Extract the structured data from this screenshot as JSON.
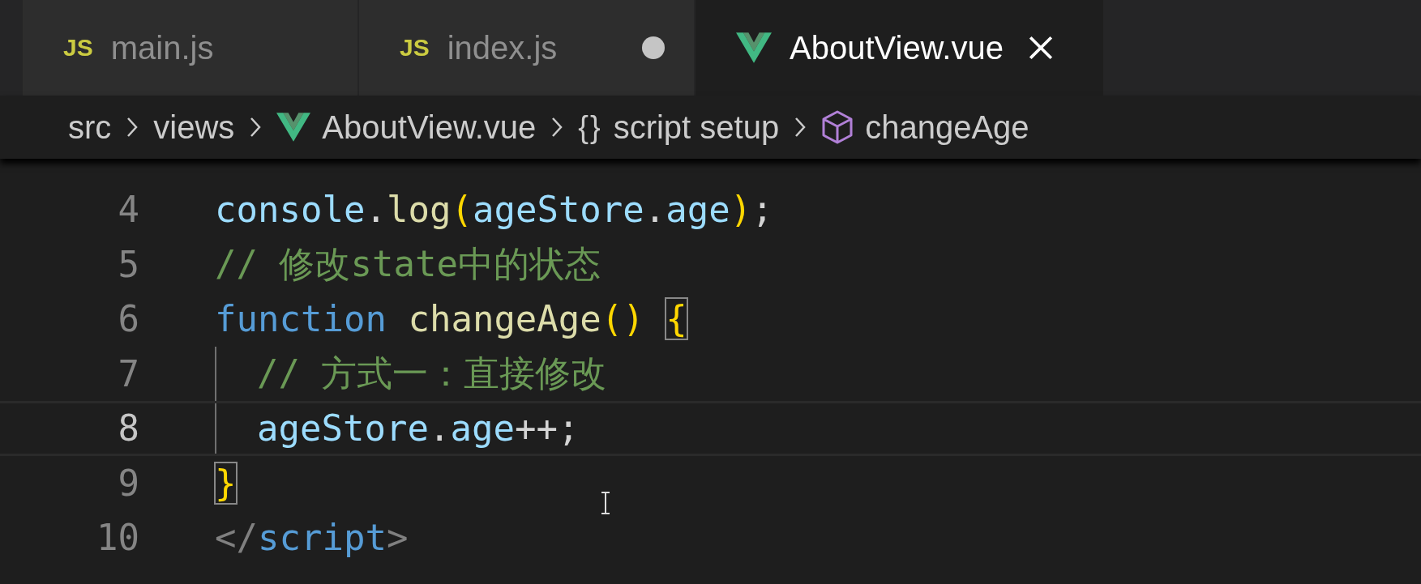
{
  "tabs": [
    {
      "kind": "js",
      "icon_label": "JS",
      "label": "main.js",
      "selected": false,
      "modified": false
    },
    {
      "kind": "js",
      "icon_label": "JS",
      "label": "index.js",
      "selected": false,
      "modified": true
    },
    {
      "kind": "vue",
      "label": "AboutView.vue",
      "selected": true,
      "modified": false
    }
  ],
  "breadcrumb": [
    {
      "kind": "folder",
      "label": "src"
    },
    {
      "kind": "folder",
      "label": "views"
    },
    {
      "kind": "vue",
      "label": "AboutView.vue"
    },
    {
      "kind": "braces",
      "icon_label": "{}",
      "label": "script setup"
    },
    {
      "kind": "symbol",
      "label": "changeAge"
    }
  ],
  "code_lines": [
    {
      "number": "4",
      "current": false,
      "indent_guide": false,
      "tokens": [
        {
          "kind": "var",
          "text": "console"
        },
        {
          "kind": "punct",
          "text": "."
        },
        {
          "kind": "fn",
          "text": "log"
        },
        {
          "kind": "bracket",
          "text": "("
        },
        {
          "kind": "var",
          "text": "ageStore"
        },
        {
          "kind": "punct",
          "text": "."
        },
        {
          "kind": "var",
          "text": "age"
        },
        {
          "kind": "bracket",
          "text": ")"
        },
        {
          "kind": "punct",
          "text": ";"
        }
      ]
    },
    {
      "number": "5",
      "current": false,
      "indent_guide": false,
      "tokens": [
        {
          "kind": "comment",
          "text": "// 修改state中的状态"
        }
      ]
    },
    {
      "number": "6",
      "current": false,
      "indent_guide": false,
      "tokens": [
        {
          "kind": "keyword",
          "text": "function "
        },
        {
          "kind": "fn",
          "text": "changeAge"
        },
        {
          "kind": "bracket",
          "text": "() "
        },
        {
          "kind": "matched",
          "text": "{"
        }
      ]
    },
    {
      "number": "7",
      "current": false,
      "indent_guide": true,
      "tokens": [
        {
          "kind": "comment",
          "text": "// 方式一：直接修改"
        }
      ]
    },
    {
      "number": "8",
      "current": true,
      "indent_guide": true,
      "tokens": [
        {
          "kind": "var",
          "text": "ageStore"
        },
        {
          "kind": "punct",
          "text": "."
        },
        {
          "kind": "var",
          "text": "age"
        },
        {
          "kind": "punct",
          "text": "++;"
        }
      ]
    },
    {
      "number": "9",
      "current": false,
      "indent_guide": false,
      "tokens": [
        {
          "kind": "matched",
          "text": "}"
        }
      ]
    },
    {
      "number": "10",
      "current": false,
      "indent_guide": false,
      "tokens": [
        {
          "kind": "tag",
          "text": "</"
        },
        {
          "kind": "keyword",
          "text": "script"
        },
        {
          "kind": "tag",
          "text": ">"
        }
      ]
    }
  ]
}
